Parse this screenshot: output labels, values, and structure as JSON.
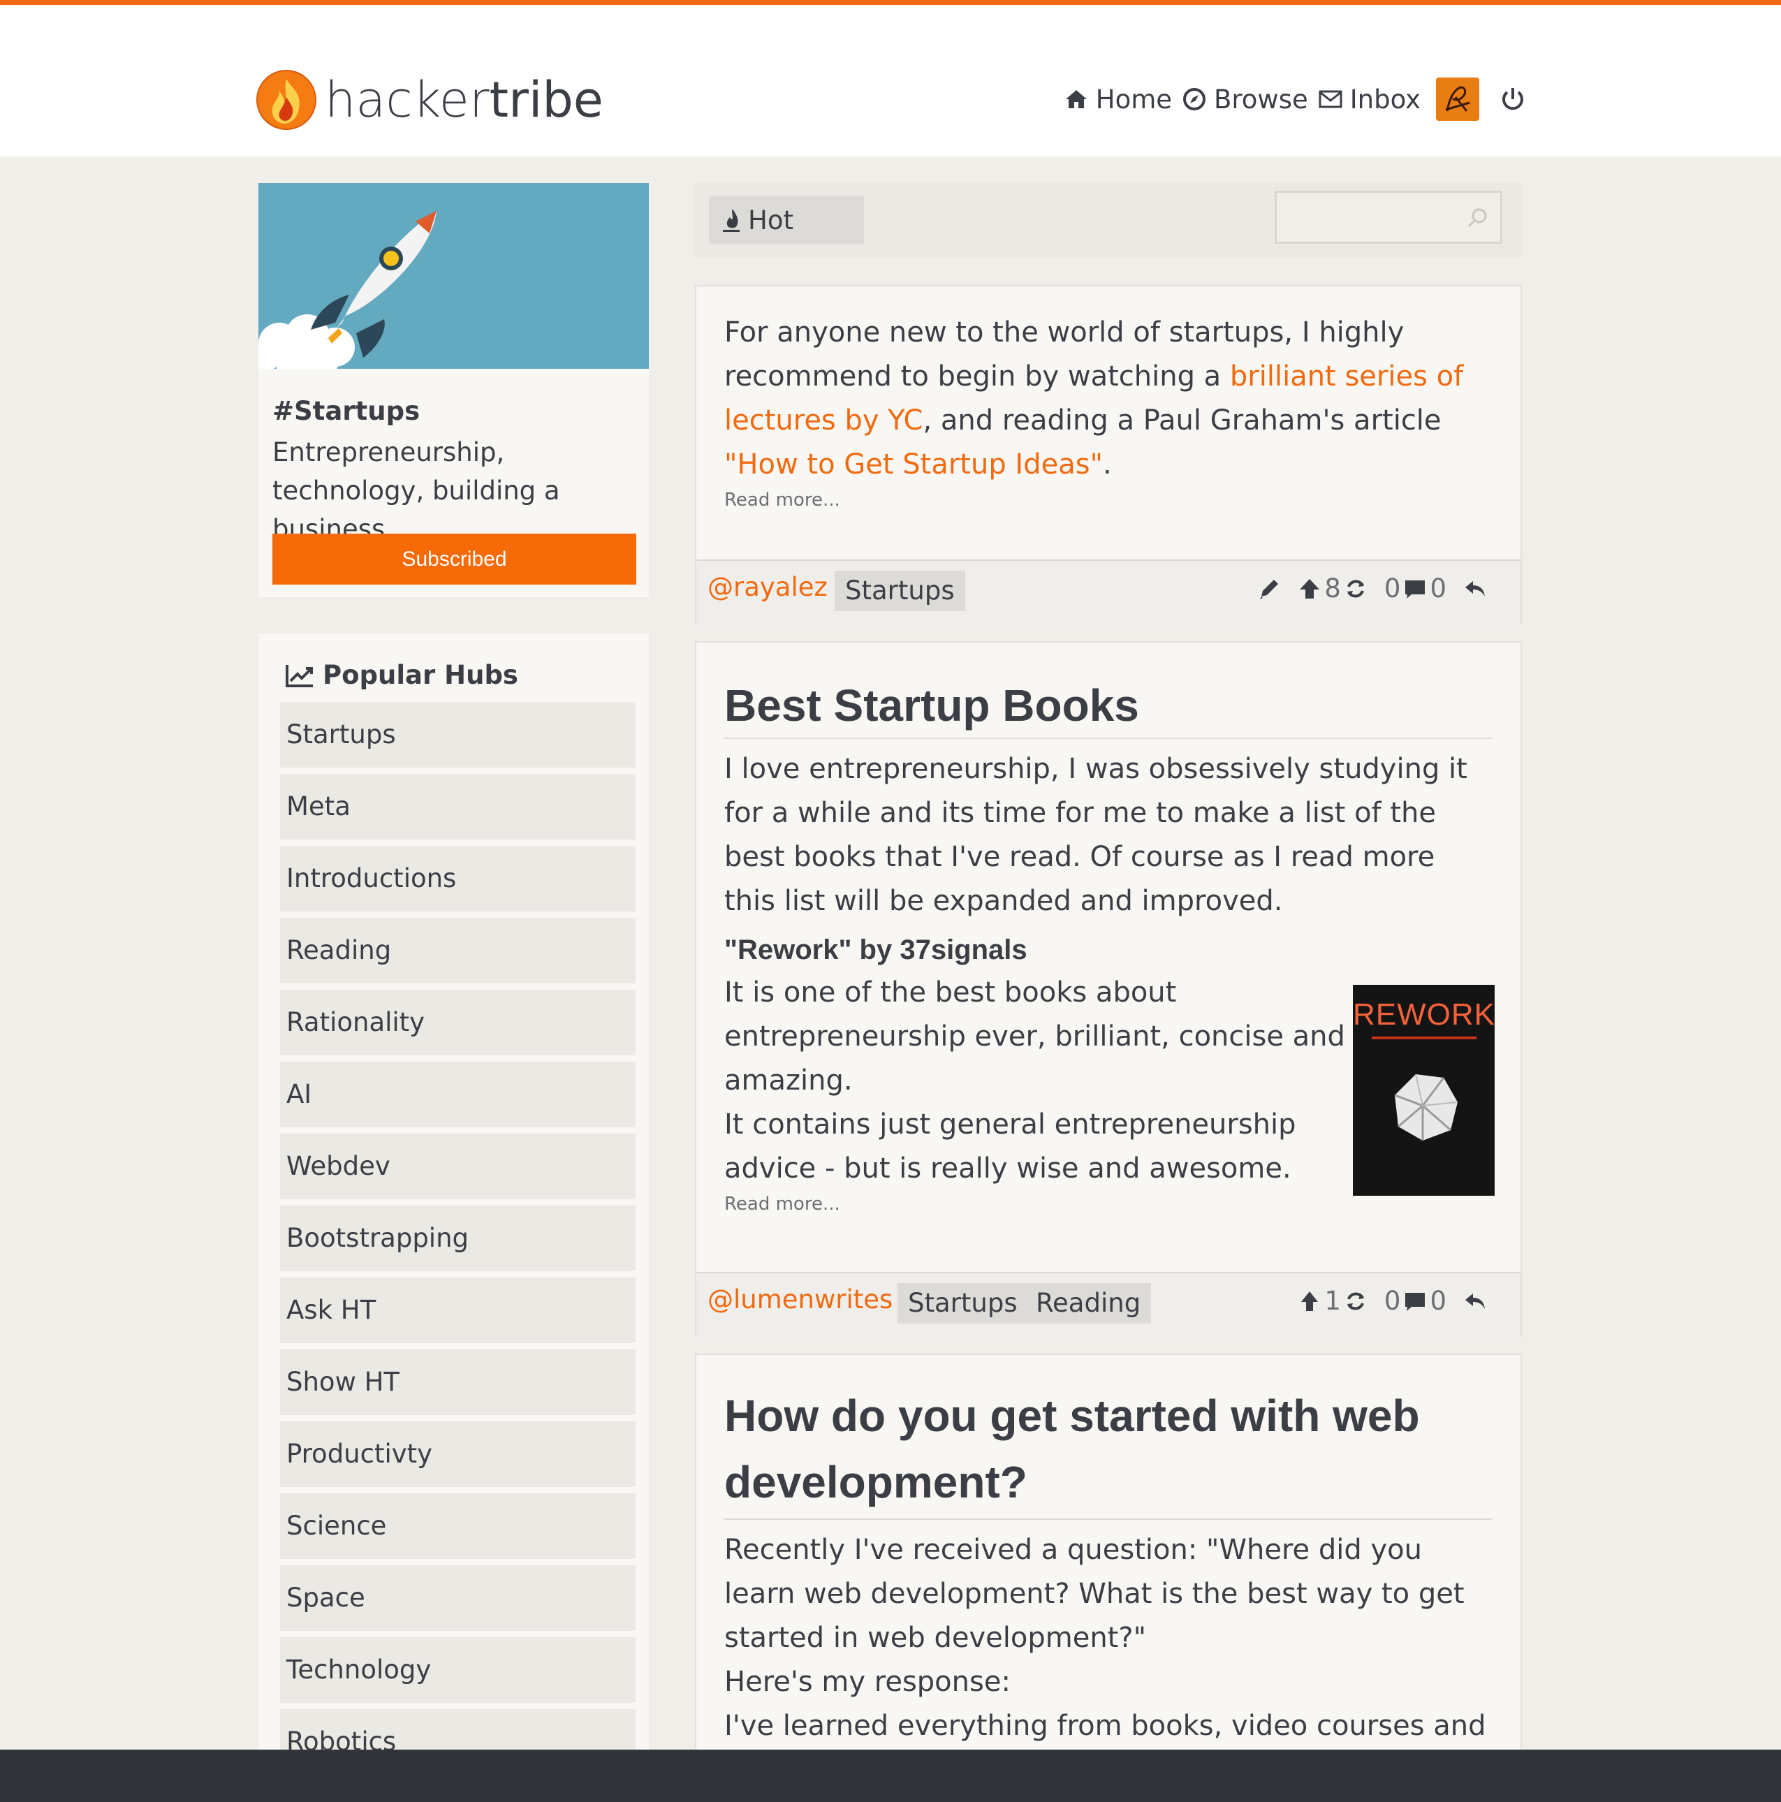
{
  "brand": {
    "prefix": "hacker",
    "suffix": "tribe",
    "accent": "#f56a10"
  },
  "nav": {
    "home": "Home",
    "browse": "Browse",
    "inbox": "Inbox"
  },
  "hub": {
    "name": "#Startups",
    "description": "Entrepreneurship, technology, building a business.",
    "button": "Subscribed"
  },
  "popular": {
    "title": "Popular Hubs",
    "items": [
      "Startups",
      "Meta",
      "Introductions",
      "Reading",
      "Rationality",
      "AI",
      "Webdev",
      "Bootstrapping",
      "Ask HT",
      "Show HT",
      "Productivty",
      "Science",
      "Space",
      "Technology",
      "Robotics"
    ]
  },
  "toolbar": {
    "sort": "Hot",
    "search_placeholder": ""
  },
  "posts": [
    {
      "text_before": "For anyone new to the world of startups, I highly recommend to begin by watching a ",
      "link1": "brilliant series of lectures by YC",
      "text_middle": ", and reading a Paul Graham's article ",
      "link2": "\"How to Get Startup Ideas\"",
      "text_after": ".",
      "read_more": "Read more...",
      "author": "@rayalez",
      "tags": [
        "Startups"
      ],
      "upvotes": "8",
      "reposts": "0",
      "comments": "0"
    },
    {
      "title": "Best Startup Books",
      "intro": "I love entrepreneurship, I was obsessively studying it for a while and its time for me to make a list of the best books that I've read. Of course as I read more this list will be expanded and improved.",
      "subtitle": "\"Rework\" by 37signals",
      "para1": "It is one of the best books about entrepreneurship ever, brilliant, concise and amazing.",
      "para2": "It contains just general entrepreneurship advice - but is really wise and awesome.",
      "book_title": "REWORK",
      "read_more": "Read more...",
      "author": "@lumenwrites",
      "tags": [
        "Startups",
        "Reading"
      ],
      "upvotes": "1",
      "reposts": "0",
      "comments": "0"
    },
    {
      "title": "How do you get started with web development?",
      "line1": "Recently I've received a question: \"Where did you learn web development? What is the best way to get started in web development?\"",
      "line2": "Here's my response:",
      "line3": "I've learned everything from books, video courses and by"
    }
  ]
}
